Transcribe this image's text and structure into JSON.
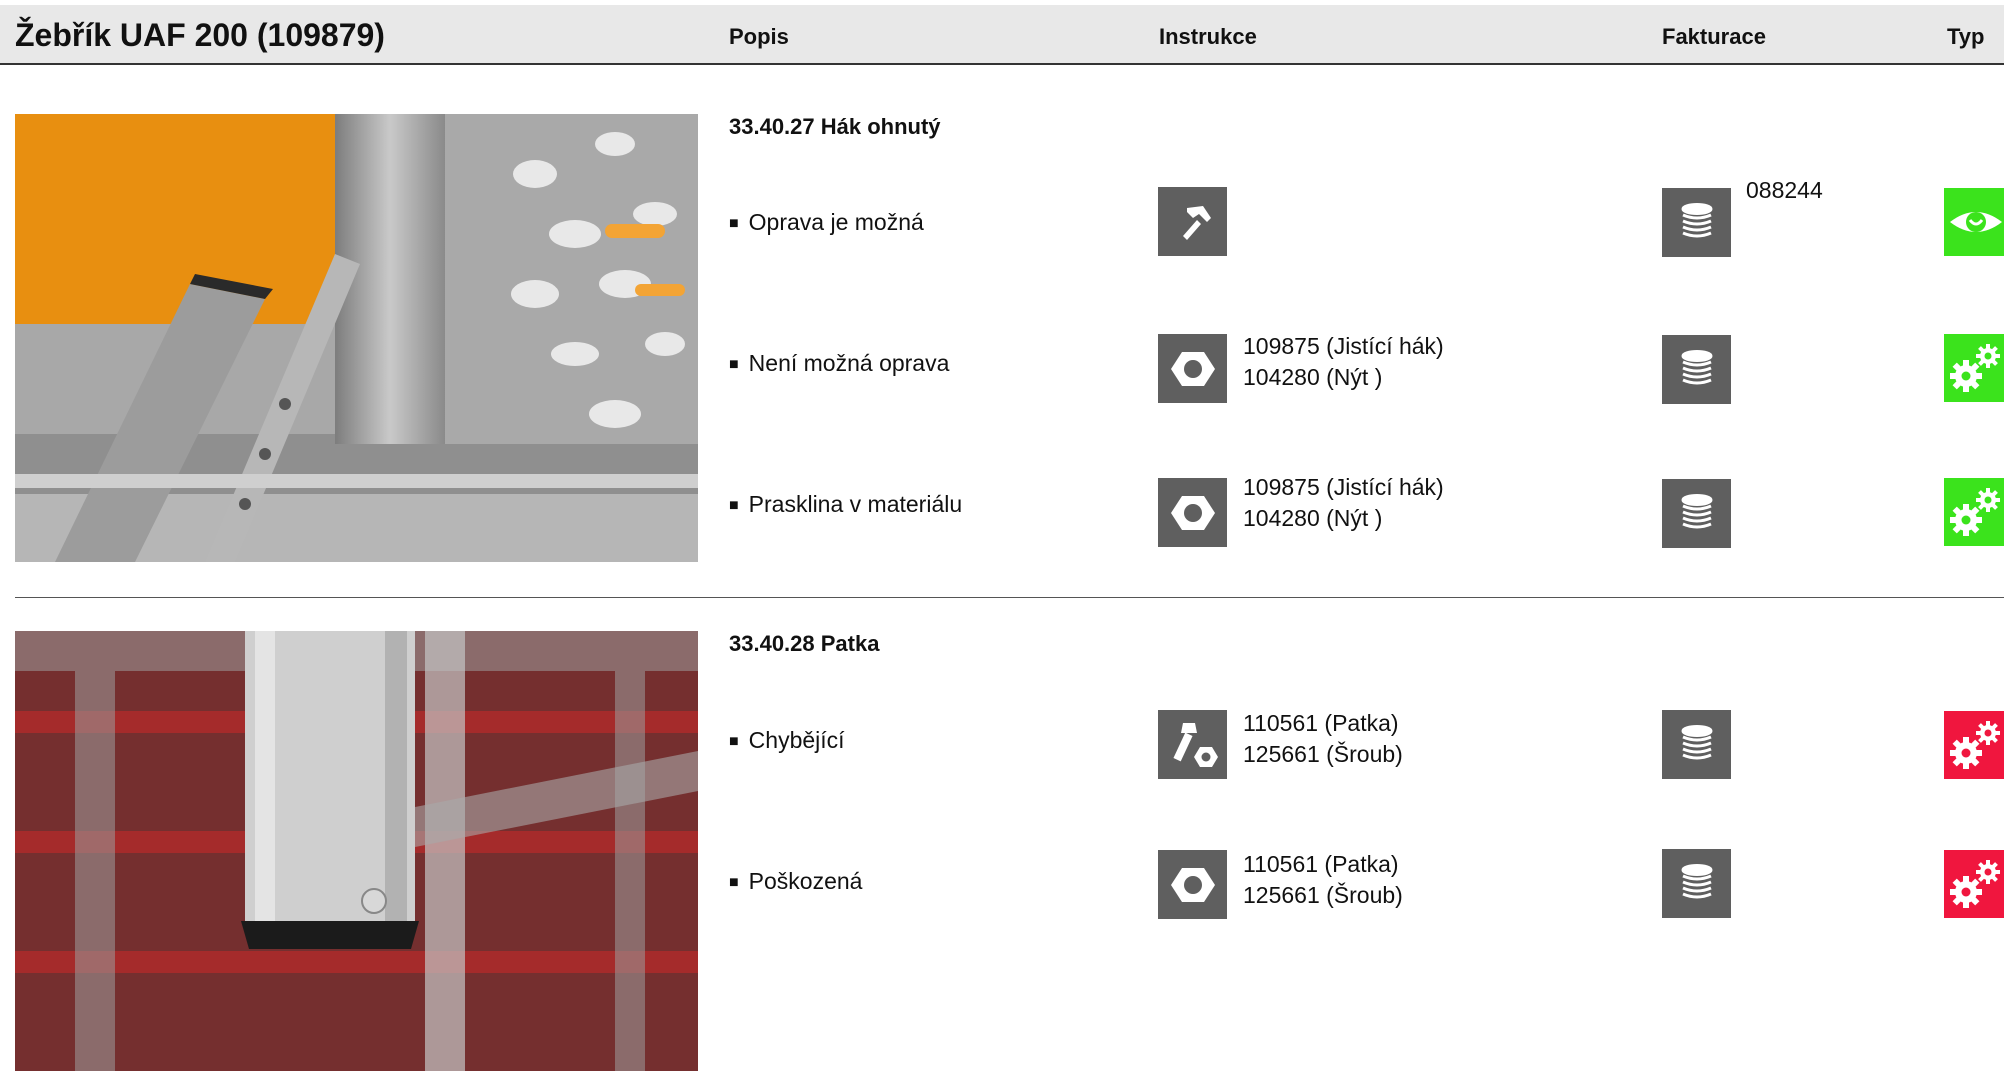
{
  "header": {
    "title": "Žebřík UAF 200 (109879)",
    "col_popis": "Popis",
    "col_instrukce": "Instrukce",
    "col_fakturace": "Fakturace",
    "col_typ": "Typ"
  },
  "sections": [
    {
      "title": "33.40.27 Hák ohnutý",
      "rows": [
        {
          "label": "Oprava je možná",
          "instr_icon": "hammer-icon",
          "materials": [],
          "invoice_icon": "coins-icon",
          "invoice_number": "088244",
          "type_icon": "eye-icon",
          "type_color": "#3be31c"
        },
        {
          "label": "Není možná oprava",
          "instr_icon": "nut-icon",
          "materials": [
            "109875 (Jistící hák)",
            "104280 (Nýt )"
          ],
          "invoice_icon": "coins-icon",
          "invoice_number": "",
          "type_icon": "gears-icon",
          "type_color": "#3be31c"
        },
        {
          "label": "Prasklina v materiálu",
          "instr_icon": "nut-icon",
          "materials": [
            "109875 (Jistící hák)",
            "104280 (Nýt )"
          ],
          "invoice_icon": "coins-icon",
          "invoice_number": "",
          "type_icon": "gears-icon",
          "type_color": "#3be31c"
        }
      ]
    },
    {
      "title": "33.40.28 Patka",
      "rows": [
        {
          "label": "Chybějící",
          "instr_icon": "bolt-nut-icon",
          "materials": [
            "110561 (Patka)",
            "125661 (Šroub)"
          ],
          "invoice_icon": "coins-icon",
          "invoice_number": "",
          "type_icon": "gears-icon",
          "type_color": "#f0163e"
        },
        {
          "label": "Poškozená",
          "instr_icon": "nut-icon",
          "materials": [
            "110561 (Patka)",
            "125661 (Šroub)"
          ],
          "invoice_icon": "coins-icon",
          "invoice_number": "",
          "type_icon": "gears-icon",
          "type_color": "#f0163e"
        }
      ]
    }
  ]
}
